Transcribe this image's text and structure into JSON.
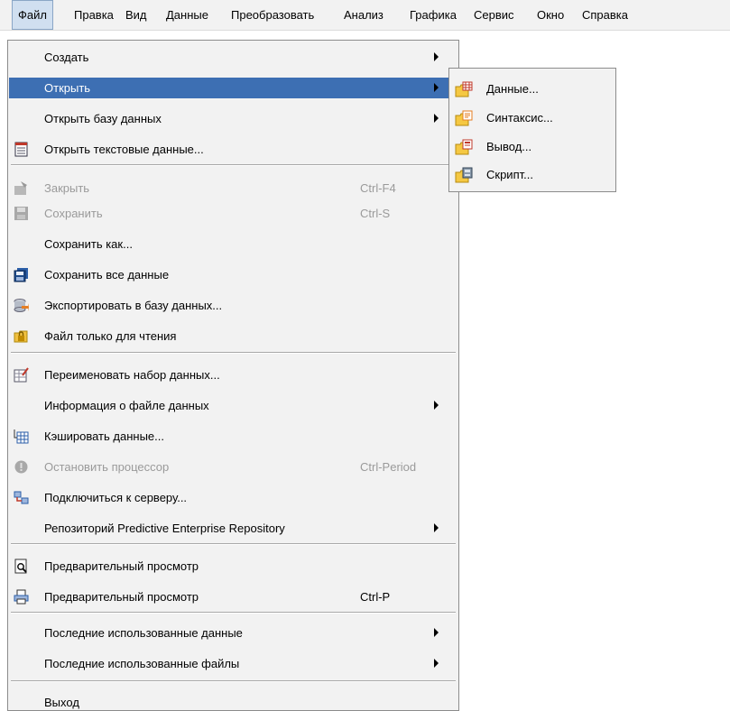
{
  "menubar": {
    "items": [
      "Файл",
      "Правка",
      "Вид",
      "Данные",
      "Преобразовать",
      "Анализ",
      "Графика",
      "Сервис",
      "Окно",
      "Справка"
    ]
  },
  "file_menu": {
    "items": [
      {
        "label": "Создать",
        "shortcut": "",
        "submenu": true
      },
      {
        "label": "Открыть",
        "shortcut": "",
        "submenu": true
      },
      {
        "label": "Открыть базу данных",
        "shortcut": "",
        "submenu": true
      },
      {
        "label": "Открыть текстовые данные...",
        "shortcut": ""
      },
      {
        "label": "Закрыть",
        "shortcut": "Ctrl-F4"
      },
      {
        "label": "Сохранить",
        "shortcut": "Ctrl-S"
      },
      {
        "label": "Сохранить как...",
        "shortcut": ""
      },
      {
        "label": "Сохранить все данные",
        "shortcut": ""
      },
      {
        "label": "Экспортировать в базу данных...",
        "shortcut": ""
      },
      {
        "label": "Файл только для чтения",
        "shortcut": ""
      },
      {
        "label": "Переименовать набор данных...",
        "shortcut": ""
      },
      {
        "label": "Информация о файле данных",
        "shortcut": "",
        "submenu": true
      },
      {
        "label": "Кэшировать данные...",
        "shortcut": ""
      },
      {
        "label": "Остановить процессор",
        "shortcut": "Ctrl-Period"
      },
      {
        "label": "Подключиться к серверу...",
        "shortcut": ""
      },
      {
        "label": "Репозиторий Predictive Enterprise Repository",
        "shortcut": "",
        "submenu": true
      },
      {
        "label": "Предварительный просмотр",
        "shortcut": ""
      },
      {
        "label": "Предварительный просмотр",
        "shortcut": "Ctrl-P"
      },
      {
        "label": "Последние использованные данные",
        "shortcut": "",
        "submenu": true
      },
      {
        "label": "Последние использованные файлы",
        "shortcut": "",
        "submenu": true
      },
      {
        "label": "Выход",
        "shortcut": ""
      }
    ]
  },
  "open_submenu": {
    "items": [
      "Данные...",
      "Синтаксис...",
      "Вывод...",
      "Скрипт..."
    ]
  },
  "colors": {
    "highlight": "#3d6fb3",
    "menu_bg": "#f2f2f2",
    "disabled_text": "#9a9a9a"
  }
}
